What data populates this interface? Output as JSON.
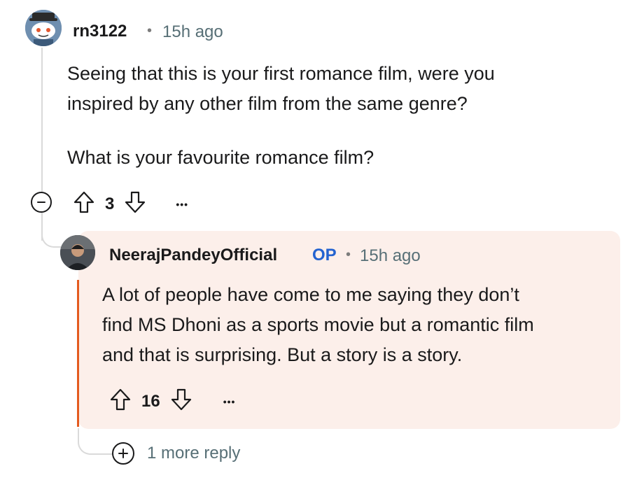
{
  "top_comment": {
    "username": "rn3122",
    "separator": "•",
    "time": "15h ago",
    "body_line1": "Seeing that this is your first romance film, were you",
    "body_line2": "inspired by any other film from the same genre?",
    "body_line3": "What is your favourite romance film?",
    "vote_count": "3",
    "more": "•••"
  },
  "reply": {
    "username": "NeerajPandeyOfficial",
    "badge": "OP",
    "separator": "•",
    "time": "15h ago",
    "body_line1": "A lot of people have come to me saying they don’t",
    "body_line2": "find MS Dhoni as a sports movie but a romantic film",
    "body_line3": "and that is surprising. But a story is a story.",
    "vote_count": "16",
    "more": "•••"
  },
  "more_replies": {
    "label": "1 more reply"
  },
  "colors": {
    "op_badge": "#2463d0",
    "reply_bg": "#fcefea",
    "reply_accent": "#e45a1f",
    "meta_text": "#576f76"
  },
  "icons": {
    "collapse": "minus-circle-icon",
    "upvote": "arrow-up-outline-icon",
    "downvote": "arrow-down-outline-icon",
    "expand": "plus-circle-icon"
  }
}
